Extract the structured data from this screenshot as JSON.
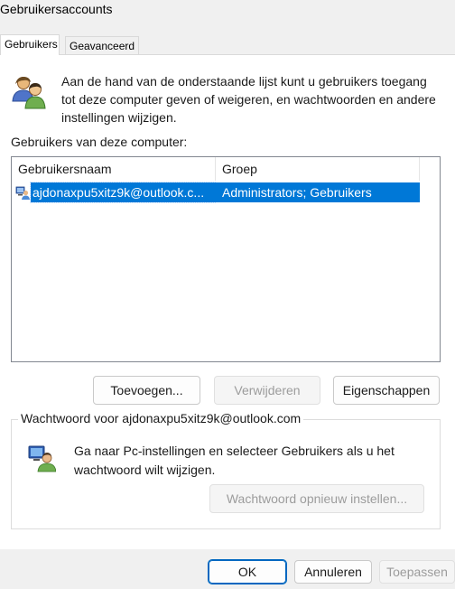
{
  "window": {
    "title": "Gebruikersaccounts"
  },
  "tabs": [
    {
      "label": "Gebruikers",
      "active": true
    },
    {
      "label": "Geavanceerd",
      "active": false
    }
  ],
  "intro": {
    "icon": "users-icon",
    "text": "Aan de hand van de onderstaande lijst kunt u gebruikers toegang tot deze computer geven of weigeren, en wachtwoorden en andere instellingen wijzigen."
  },
  "users_section": {
    "label": "Gebruikers van deze computer:",
    "columns": [
      "Gebruikersnaam",
      "Groep"
    ],
    "rows": [
      {
        "icon": "user-icon",
        "name": "ajdonaxpu5xitz9k@outlook.c...",
        "group": "Administrators; Gebruikers",
        "selected": true
      }
    ]
  },
  "list_buttons": {
    "add": "Toevoegen...",
    "remove": "Verwijderen",
    "properties": "Eigenschappen"
  },
  "password_group": {
    "label": "Wachtwoord voor ajdonaxpu5xitz9k@outlook.com",
    "icon": "user-settings-icon",
    "text": "Ga naar Pc-instellingen en selecteer Gebruikers als u het wachtwoord wilt wijzigen.",
    "reset_button": "Wachtwoord opnieuw instellen..."
  },
  "footer": {
    "ok": "OK",
    "cancel": "Annuleren",
    "apply": "Toepassen"
  },
  "colors": {
    "selection": "#0078d7",
    "accent": "#0067c0"
  }
}
